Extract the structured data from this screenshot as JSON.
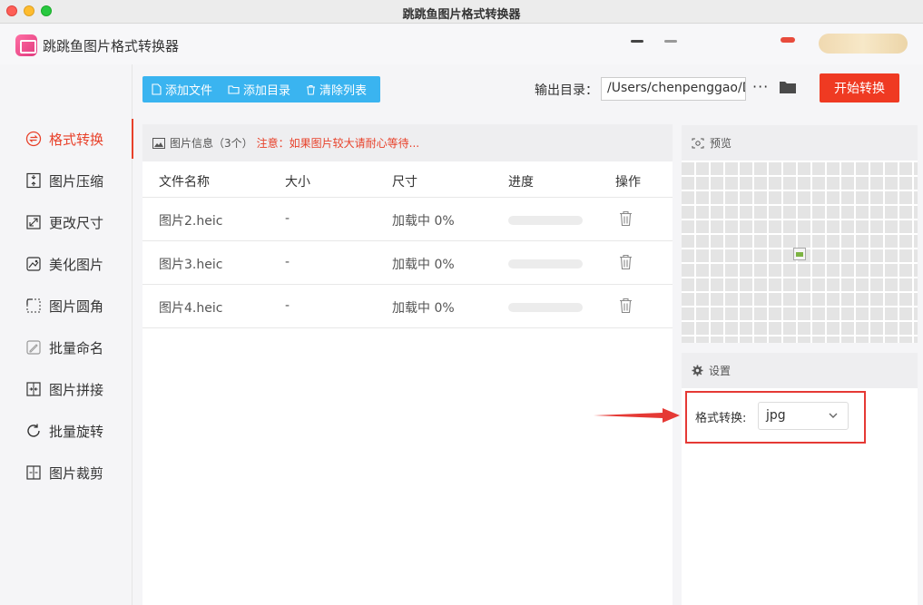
{
  "window": {
    "title": "跳跳鱼图片格式转换器"
  },
  "app": {
    "name": "跳跳鱼图片格式转换器"
  },
  "sidebar": {
    "items": [
      {
        "label": "格式转换",
        "icon": "format-convert-icon",
        "active": true
      },
      {
        "label": "图片压缩",
        "icon": "compress-icon",
        "active": false
      },
      {
        "label": "更改尺寸",
        "icon": "resize-icon",
        "active": false
      },
      {
        "label": "美化图片",
        "icon": "beautify-icon",
        "active": false
      },
      {
        "label": "图片圆角",
        "icon": "rounded-corner-icon",
        "active": false
      },
      {
        "label": "批量命名",
        "icon": "rename-icon",
        "active": false
      },
      {
        "label": "图片拼接",
        "icon": "stitch-icon",
        "active": false
      },
      {
        "label": "批量旋转",
        "icon": "rotate-icon",
        "active": false
      },
      {
        "label": "图片裁剪",
        "icon": "crop-icon",
        "active": false
      }
    ]
  },
  "toolbar": {
    "add_file": "添加文件",
    "add_dir": "添加目录",
    "clear_list": "清除列表",
    "output_label": "输出目录：",
    "output_path": "/Users/chenpenggao/D",
    "more": "···",
    "start": "开始转换"
  },
  "file_panel": {
    "header": "图片信息（3个）",
    "warning": "注意：如果图片较大请耐心等待...",
    "columns": [
      "文件名称",
      "大小",
      "尺寸",
      "进度",
      "操作"
    ],
    "rows": [
      {
        "name": "图片2.heic",
        "size": "-",
        "dims": "加载中 0%",
        "progress": 0
      },
      {
        "name": "图片3.heic",
        "size": "-",
        "dims": "加载中 0%",
        "progress": 0
      },
      {
        "name": "图片4.heic",
        "size": "-",
        "dims": "加载中 0%",
        "progress": 0
      }
    ]
  },
  "preview": {
    "title": "预览"
  },
  "settings": {
    "title": "设置",
    "format_label": "格式转换:",
    "format_value": "jpg"
  },
  "colors": {
    "accent": "#ef3a22",
    "toolbar": "#3ab4f0",
    "annotation": "#e53935"
  }
}
